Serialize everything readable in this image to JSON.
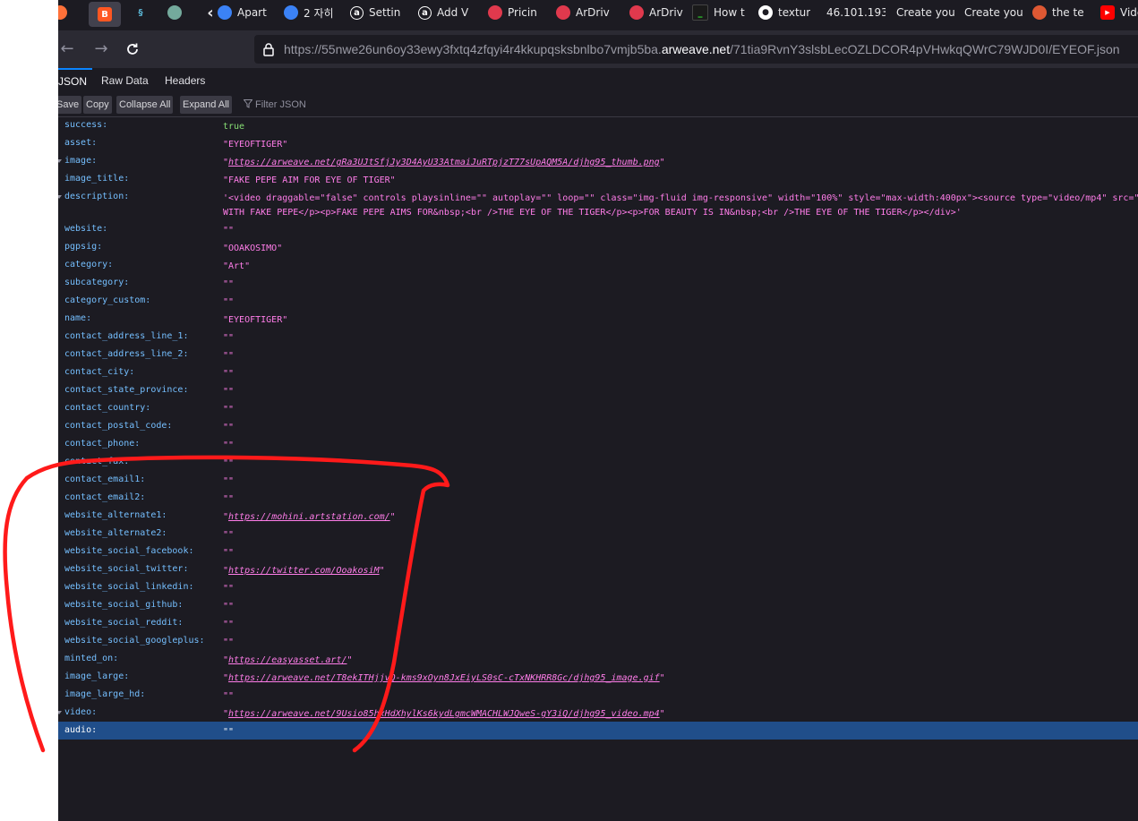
{
  "tabs": [
    {
      "label": "",
      "icon": "firefox-icon",
      "color": "#ff7139"
    },
    {
      "label": "",
      "icon": "blogger-icon",
      "color": "#ff5722",
      "active": true
    },
    {
      "label": "",
      "icon": "kraken-icon",
      "color": "#5bb7d6"
    },
    {
      "label": "",
      "icon": "chatgpt-icon",
      "color": "#74aa9c"
    },
    {
      "label": "",
      "icon": "chevron-left-icon",
      "color": "#e8e8ea"
    },
    {
      "label": "Apart",
      "icon": "globe-icon",
      "color": "#3b82f6"
    },
    {
      "label": "2 자히",
      "icon": "upload-icon",
      "color": "#3b82f6"
    },
    {
      "label": "Settin",
      "icon": "circle-a-icon",
      "color": "#ffffff"
    },
    {
      "label": "Add V",
      "icon": "circle-a-icon",
      "color": "#ffffff"
    },
    {
      "label": "Pricin",
      "icon": "ardrive-icon",
      "color": "#e0394d"
    },
    {
      "label": "ArDriv",
      "icon": "ardrive-icon",
      "color": "#e0394d"
    },
    {
      "label": "ArDriv",
      "icon": "ardrive-icon",
      "color": "#e0394d"
    },
    {
      "label": "How t",
      "icon": "terminal-icon",
      "color": "#1a1a1a"
    },
    {
      "label": "textur",
      "icon": "github-icon",
      "color": "#ffffff"
    },
    {
      "label": "46.101.193",
      "icon": "",
      "color": ""
    },
    {
      "label": "Create you",
      "icon": "",
      "color": ""
    },
    {
      "label": "Create you",
      "icon": "",
      "color": ""
    },
    {
      "label": "the te",
      "icon": "duckduckgo-icon",
      "color": "#de5833"
    },
    {
      "label": "Vide",
      "icon": "youtube-icon",
      "color": "#ff0000"
    }
  ],
  "nav": {
    "url_prefix": "https://55nwe26un6oy33ewy3fxtq4zfqyi4r4kkupqsksbnlbo7vmjb5ba.",
    "url_host": "arweave.net",
    "url_path": "/71tia9RvnY3slsbLecOZLDCOR4pVHwkqQWrC79WJD0I/EYEOF.json"
  },
  "view_tabs": [
    "JSON",
    "Raw Data",
    "Headers"
  ],
  "toolbar": {
    "save": "Save",
    "copy": "Copy",
    "collapse_all": "Collapse All",
    "expand_all": "Expand All",
    "filter_placeholder": "Filter JSON"
  },
  "rows": [
    {
      "key": "success:",
      "value": "true",
      "type": "bool"
    },
    {
      "key": "asset:",
      "value": "\"EYEOFTIGER\"",
      "type": "string"
    },
    {
      "key": "image:",
      "value": "https://arweave.net/gRa3UJtSfjJy3D4AyU33AtmaiJuRTpjzT77sUpAQM5A/djhg95_thumb.png",
      "type": "link",
      "expandable": true
    },
    {
      "key": "image_title:",
      "value": "\"FAKE PEPE AIM FOR EYE OF TIGER\"",
      "type": "string"
    },
    {
      "key": "description:",
      "value": "'<video draggable=\"false\" controls playsinline=\"\" autoplay=\"\" loop=\"\" class=\"img-fluid img-responsive\" width=\"100%\" style=\"max-width:400px\"><source type=\"video/mp4\" src=\"",
      "value2": "WITH FAKE PEPE</p><p>FAKE PEPE AIMS FOR&nbsp;<br />THE EYE OF THE TIGER</p><p>FOR BEAUTY IS IN&nbsp;<br />THE EYE OF THE TIGER</p></div>'",
      "type": "string",
      "expandable": true
    },
    {
      "key": "website:",
      "value": "\"\"",
      "type": "string"
    },
    {
      "key": "pgpsig:",
      "value": "\"OOAKOSIMO\"",
      "type": "string"
    },
    {
      "key": "category:",
      "value": "\"Art\"",
      "type": "string"
    },
    {
      "key": "subcategory:",
      "value": "\"\"",
      "type": "string"
    },
    {
      "key": "category_custom:",
      "value": "\"\"",
      "type": "string"
    },
    {
      "key": "name:",
      "value": "\"EYEOFTIGER\"",
      "type": "string"
    },
    {
      "key": "contact_address_line_1:",
      "value": "\"\"",
      "type": "string"
    },
    {
      "key": "contact_address_line_2:",
      "value": "\"\"",
      "type": "string"
    },
    {
      "key": "contact_city:",
      "value": "\"\"",
      "type": "string"
    },
    {
      "key": "contact_state_province:",
      "value": "\"\"",
      "type": "string"
    },
    {
      "key": "contact_country:",
      "value": "\"\"",
      "type": "string"
    },
    {
      "key": "contact_postal_code:",
      "value": "\"\"",
      "type": "string"
    },
    {
      "key": "contact_phone:",
      "value": "\"\"",
      "type": "string"
    },
    {
      "key": "contact_fax:",
      "value": "\"\"",
      "type": "string"
    },
    {
      "key": "contact_email1:",
      "value": "\"\"",
      "type": "string"
    },
    {
      "key": "contact_email2:",
      "value": "\"\"",
      "type": "string"
    },
    {
      "key": "website_alternate1:",
      "value": "https://mohini.artstation.com/",
      "type": "link"
    },
    {
      "key": "website_alternate2:",
      "value": "\"\"",
      "type": "string"
    },
    {
      "key": "website_social_facebook:",
      "value": "\"\"",
      "type": "string"
    },
    {
      "key": "website_social_twitter:",
      "value": "https://twitter.com/OoakosiM",
      "type": "link"
    },
    {
      "key": "website_social_linkedin:",
      "value": "\"\"",
      "type": "string"
    },
    {
      "key": "website_social_github:",
      "value": "\"\"",
      "type": "string"
    },
    {
      "key": "website_social_reddit:",
      "value": "\"\"",
      "type": "string"
    },
    {
      "key": "website_social_googleplus:",
      "value": "\"\"",
      "type": "string"
    },
    {
      "key": "minted_on:",
      "value": "https://easyasset.art/",
      "type": "link"
    },
    {
      "key": "image_large:",
      "value": "https://arweave.net/T8ekITHjjvQ-kms9xOyn8JxEiyLS0sC-cTxNKHRR8Gc/djhg95_image.gif",
      "type": "link"
    },
    {
      "key": "image_large_hd:",
      "value": "\"\"",
      "type": "string"
    },
    {
      "key": "video:",
      "value": "https://arweave.net/9Usio85hxHdXhylKs6kydLgmcWMACHLWJQweS-gY3iQ/djhg95_video.mp4",
      "type": "link",
      "expandable": true
    },
    {
      "key": "audio:",
      "value": "\"\"",
      "type": "string",
      "selected": true
    }
  ],
  "colors": {
    "annotation": "#ff1a1a",
    "selection": "#204e8a",
    "key": "#75bfff",
    "string": "#ff7de9",
    "bool": "#86de74"
  }
}
